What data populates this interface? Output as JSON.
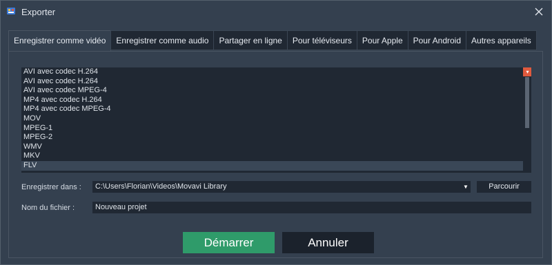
{
  "window": {
    "title": "Exporter"
  },
  "tabs": [
    {
      "label": "Enregistrer comme vidéo",
      "active": true
    },
    {
      "label": "Enregistrer comme audio",
      "active": false
    },
    {
      "label": "Partager en ligne",
      "active": false
    },
    {
      "label": "Pour téléviseurs",
      "active": false
    },
    {
      "label": "Pour Apple",
      "active": false
    },
    {
      "label": "Pour Android",
      "active": false
    },
    {
      "label": "Autres appareils",
      "active": false
    }
  ],
  "formats": {
    "items": [
      "AVI avec codec H.264",
      "AVI avec codec H.264",
      "AVI avec codec MPEG-4",
      "MP4 avec codec H.264",
      "MP4 avec codec MPEG-4",
      "MOV",
      "MPEG-1",
      "MPEG-2",
      "WMV",
      "MKV",
      "FLV"
    ],
    "selected_index": 10
  },
  "save_location": {
    "label": "Enregistrer dans :",
    "value": "C:\\Users\\Florian\\Videos\\Movavi Library",
    "browse_label": "Parcourir"
  },
  "file_name": {
    "label": "Nom du fichier :",
    "value": "Nouveau projet"
  },
  "actions": {
    "start_label": "Démarrer",
    "cancel_label": "Annuler"
  },
  "colors": {
    "accent_start": "#2f9b6a",
    "scroll_arrow": "#e05a3e",
    "window_bg": "#34404f",
    "field_bg": "#202833"
  }
}
